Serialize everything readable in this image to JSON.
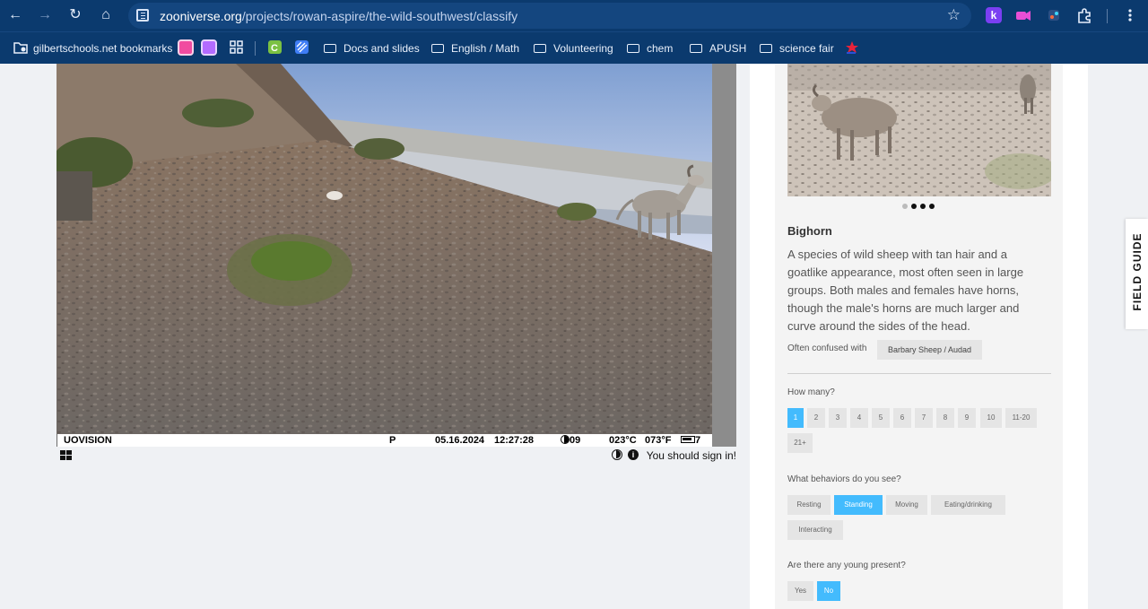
{
  "browser": {
    "url_host": "zooniverse.org",
    "url_path": "/projects/rowan-aspire/the-wild-southwest/classify",
    "extensions": [
      "k"
    ]
  },
  "bookmarks": {
    "apps_label": "gilbertschools.net bookmarks",
    "folders": [
      "Docs and slides",
      "English / Math",
      "Volunteering",
      "chem",
      "APUSH",
      "science fair"
    ]
  },
  "camera": {
    "brand": "UOVISION",
    "mode": "P",
    "date": "05.16.2024",
    "time": "12:27:28",
    "moon": "09",
    "temp_c": "023°C",
    "temp_f": "073°F",
    "battery_suffix": "7"
  },
  "subject_viewer": {
    "signin_text": "You should sign in!"
  },
  "species": {
    "name": "Bighorn",
    "description": "A species of wild sheep with tan hair and a goatlike appearance, most often seen in large groups. Both males and females have horns, though the male's horns are much larger and curve around the sides of the head.",
    "confused_label": "Often confused with",
    "confused_with": "Barbary Sheep / Audad"
  },
  "questions": {
    "how_many": {
      "label": "How many?",
      "options": [
        "1",
        "2",
        "3",
        "4",
        "5",
        "6",
        "7",
        "8",
        "9",
        "10",
        "11-20",
        "21+"
      ],
      "selected": "1"
    },
    "behaviors": {
      "label": "What behaviors do you see?",
      "options": [
        "Resting",
        "Standing",
        "Moving",
        "Eating/drinking",
        "Interacting"
      ],
      "selected": "Standing"
    },
    "young": {
      "label": "Are there any young present?",
      "options": [
        "Yes",
        "No"
      ],
      "selected": "No"
    }
  },
  "field_guide_label": "FIELD GUIDE",
  "colors": {
    "chrome": "#0b3a6e",
    "accent": "#43bbfd",
    "chip": "#e5e5e5"
  }
}
